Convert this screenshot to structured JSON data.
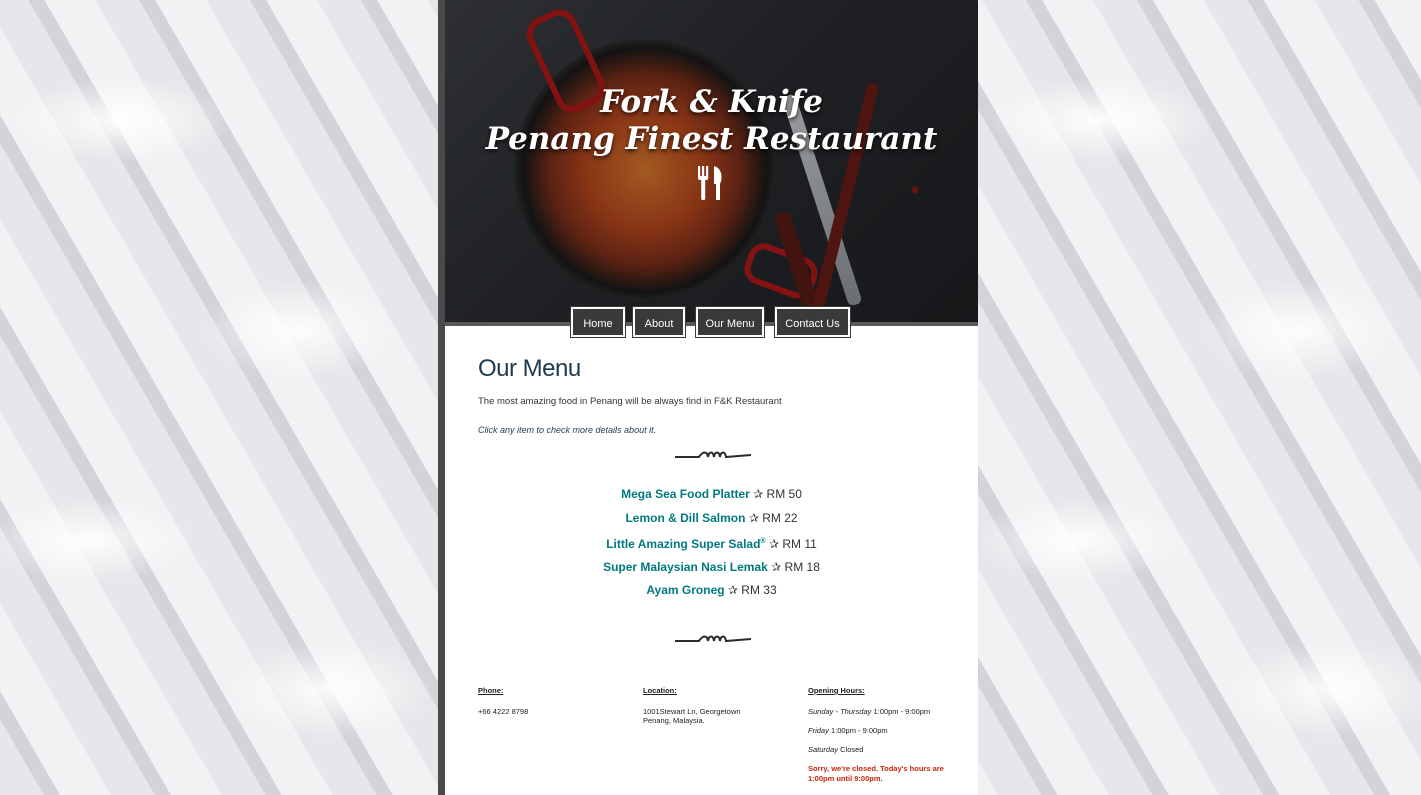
{
  "hero": {
    "title_line1": "Fork & Knife",
    "title_line2": "Penang Finest Restaurant",
    "icon": "fork-knife-icon"
  },
  "nav": {
    "items": [
      "Home",
      "About",
      "Our Menu",
      "Contact Us"
    ]
  },
  "main": {
    "heading": "Our Menu",
    "intro": "The most amazing food in Penang will be always find in F&K Restaurant",
    "hint": "Click any item to check more details about it.",
    "menu": [
      {
        "name": "Mega Sea Food Platter",
        "price": "✰ RM 50"
      },
      {
        "name": "Lemon & Dill Salmon",
        "price": "✰ RM 22"
      },
      {
        "name": "Little Amazing Super Salad",
        "sup": "®",
        "price": "✰ RM 11"
      },
      {
        "name": "Super Malaysian Nasi Lemak",
        "price": "✰ RM 18"
      },
      {
        "name": "Ayam Groneg",
        "price": "✰ RM 33"
      }
    ]
  },
  "footer": {
    "phone_label": "Phone:",
    "phone": "+66 4222 8798",
    "location_label": "Location:",
    "location_line1": "1001Stewart Ln, Georgetown",
    "location_line2": "Penang, Malaysia.",
    "hours_label": "Opening Hours:",
    "hours": [
      {
        "day": "Sunday - Thursday",
        "time": "1:00pm - 9:00pm"
      },
      {
        "day": "Friday",
        "time": "1:00pm - 9:00pm"
      },
      {
        "day": "Saturday",
        "time": "Closed"
      }
    ],
    "closed_notice": "Sorry, we're closed. Today's hours are 1:00pm until 9:00pm."
  },
  "colors": {
    "accent": "#007a80",
    "heading": "#1f3a4d",
    "nav_bg": "#3a3a3a",
    "closed": "#c8260b"
  }
}
